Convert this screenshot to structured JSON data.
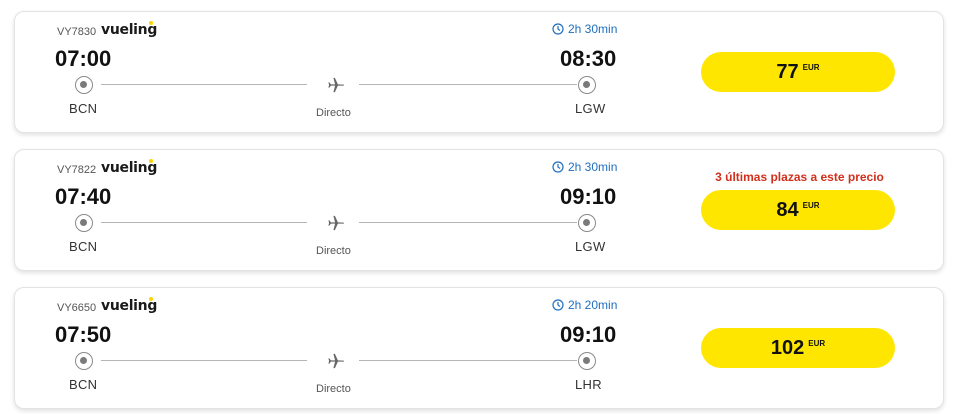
{
  "flights": [
    {
      "flight_number": "VY7830",
      "airline": "vueling",
      "duration": "2h 30min",
      "departure_time": "07:00",
      "arrival_time": "08:30",
      "origin": "BCN",
      "destination": "LGW",
      "stops": "Directo",
      "urgency": "",
      "price": "77",
      "currency": "EUR"
    },
    {
      "flight_number": "VY7822",
      "airline": "vueling",
      "duration": "2h 30min",
      "departure_time": "07:40",
      "arrival_time": "09:10",
      "origin": "BCN",
      "destination": "LGW",
      "stops": "Directo",
      "urgency": "3 últimas plazas a este precio",
      "price": "84",
      "currency": "EUR"
    },
    {
      "flight_number": "VY6650",
      "airline": "vueling",
      "duration": "2h 20min",
      "departure_time": "07:50",
      "arrival_time": "09:10",
      "origin": "BCN",
      "destination": "LHR",
      "stops": "Directo",
      "urgency": "",
      "price": "102",
      "currency": "EUR"
    }
  ],
  "colors": {
    "price_button": "#ffe600",
    "duration_text": "#1f6fbf",
    "urgency_text": "#d1301c",
    "brand_accent": "#ffd400"
  },
  "icons": {
    "duration": "clock-icon",
    "route": "airplane-icon",
    "stop": "radio-dot-icon"
  }
}
